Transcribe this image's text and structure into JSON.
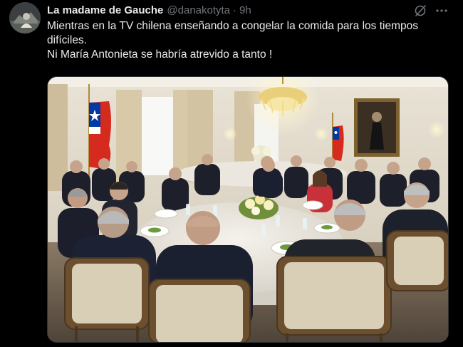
{
  "tweet": {
    "author": {
      "display_name": "La madame de Gauche",
      "handle": "@danakotyta",
      "separator": "·",
      "time": "9h"
    },
    "text_lines": [
      "Mientras en la TV chilena enseñando a congelar la comida para los tiempos difíciles.",
      "Ni María Antonieta se habría atrevido a tanto !"
    ],
    "media": {
      "subject": "state-banquet-photo",
      "flags": [
        "flag-of-chile-left",
        "flag-of-chile-right"
      ]
    }
  },
  "icons": {
    "grok": "grok-icon",
    "more": "more-options-icon"
  },
  "colors": {
    "background": "#000000",
    "text_primary": "#e7e9ea",
    "text_secondary": "#71767b",
    "border": "#2f3336",
    "flag_red": "#d52b1e",
    "flag_blue": "#0039a6"
  }
}
